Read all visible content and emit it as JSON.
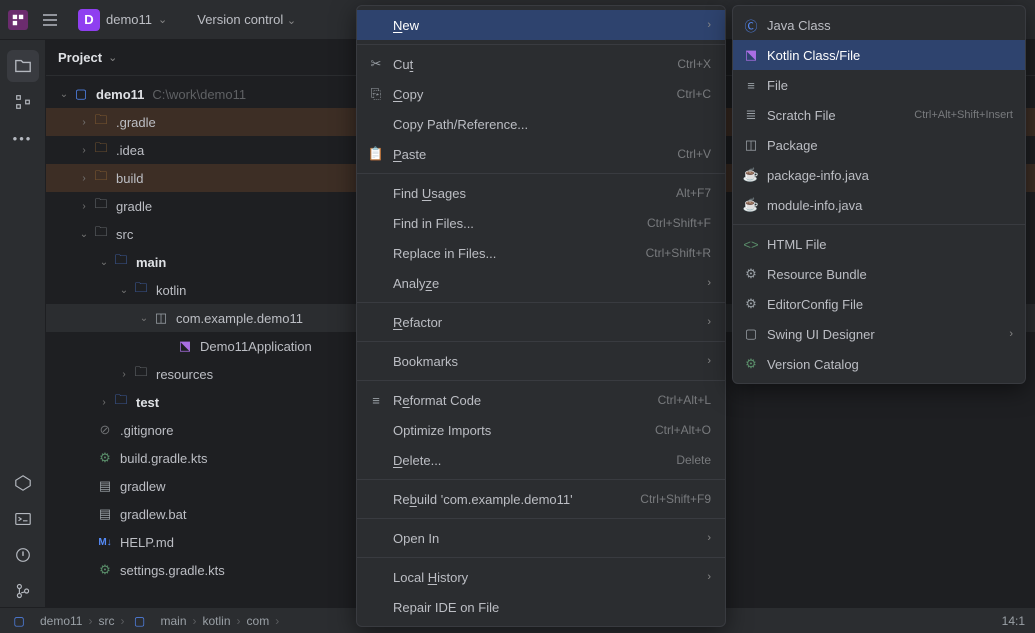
{
  "topbar": {
    "project_initial": "D",
    "project_name": "demo11",
    "vc_label": "Version control"
  },
  "panel": {
    "title": "Project"
  },
  "tree": {
    "root": {
      "label": "demo11",
      "hint": "C:\\work\\demo11"
    },
    "items": [
      {
        "label": ".gradle"
      },
      {
        "label": ".idea"
      },
      {
        "label": "build"
      },
      {
        "label": "gradle"
      },
      {
        "label": "src"
      },
      {
        "label": "main"
      },
      {
        "label": "kotlin"
      },
      {
        "label": "com.example.demo11"
      },
      {
        "label": "Demo11Application"
      },
      {
        "label": "resources"
      },
      {
        "label": "test"
      },
      {
        "label": ".gitignore"
      },
      {
        "label": "build.gradle.kts"
      },
      {
        "label": "gradlew"
      },
      {
        "label": "gradlew.bat"
      },
      {
        "label": "HELP.md"
      },
      {
        "label": "settings.gradle.kts"
      }
    ]
  },
  "ctx": {
    "new": "New",
    "cut": {
      "label": "Cut",
      "shortcut": "Ctrl+X"
    },
    "copy": {
      "label": "Copy",
      "shortcut": "Ctrl+C"
    },
    "copypath": "Copy Path/Reference...",
    "paste": {
      "label": "Paste",
      "shortcut": "Ctrl+V"
    },
    "findusages": {
      "label": "Find Usages",
      "shortcut": "Alt+F7"
    },
    "findinfiles": {
      "label": "Find in Files...",
      "shortcut": "Ctrl+Shift+F"
    },
    "replaceinfiles": {
      "label": "Replace in Files...",
      "shortcut": "Ctrl+Shift+R"
    },
    "analyze": "Analyze",
    "refactor": "Refactor",
    "bookmarks": "Bookmarks",
    "reformat": {
      "label": "Reformat Code",
      "shortcut": "Ctrl+Alt+L"
    },
    "optimize": {
      "label": "Optimize Imports",
      "shortcut": "Ctrl+Alt+O"
    },
    "delete": {
      "label": "Delete...",
      "shortcut": "Delete"
    },
    "rebuild": {
      "label": "Rebuild 'com.example.demo11'",
      "shortcut": "Ctrl+Shift+F9"
    },
    "openin": "Open In",
    "localhistory": "Local History",
    "repairide": "Repair IDE on File"
  },
  "sub": {
    "javaclass": "Java Class",
    "kotlinclass": "Kotlin Class/File",
    "file": "File",
    "scratch": {
      "label": "Scratch File",
      "shortcut": "Ctrl+Alt+Shift+Insert"
    },
    "package": "Package",
    "packageinfo": "package-info.java",
    "moduleinfo": "module-info.java",
    "html": "HTML File",
    "resourcebundle": "Resource Bundle",
    "editorconfig": "EditorConfig File",
    "swing": "Swing UI Designer",
    "versioncatalog": "Version Catalog"
  },
  "breadcrumb": {
    "parts": [
      "demo11",
      "src",
      "main",
      "kotlin",
      "com"
    ]
  },
  "status": {
    "linecol": "14:1"
  }
}
